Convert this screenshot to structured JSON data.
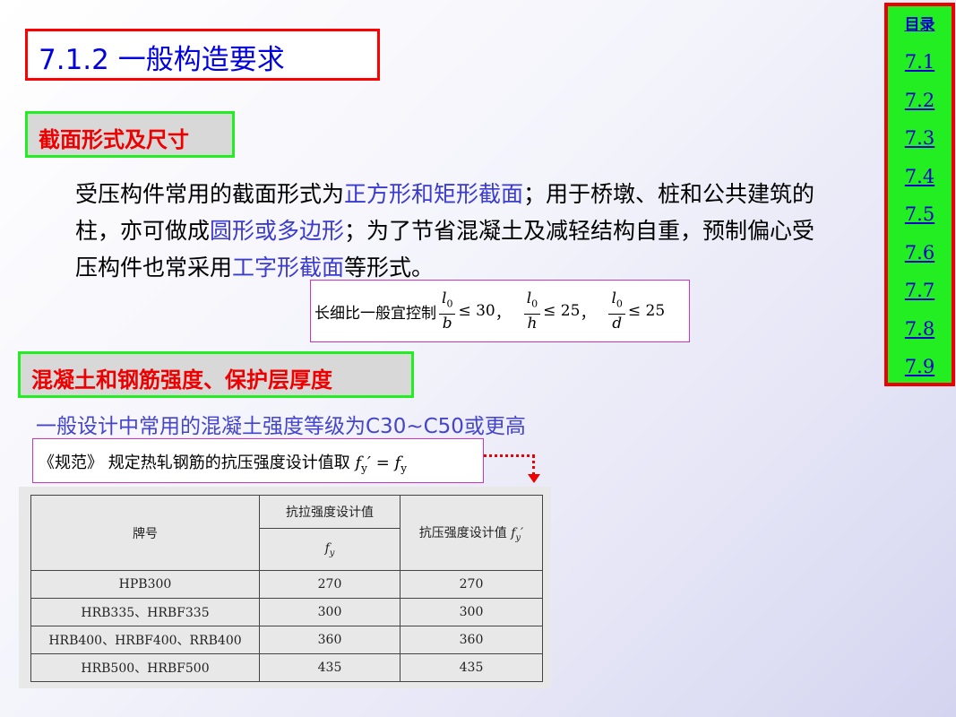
{
  "title": "7.1.2 一般构造要求",
  "section1": "截面形式及尺寸",
  "paragraph": [
    {
      "t": "受压构件常用的截面形式为",
      "hl": false
    },
    {
      "t": "正方形和矩形截面",
      "hl": true
    },
    {
      "t": "；用于桥墩、桩和公共建筑的柱，亦可做成",
      "hl": false
    },
    {
      "t": "圆形或多边形",
      "hl": true
    },
    {
      "t": "；为了节省混凝土及减轻结构自重，预制偏心受压构件也常采用",
      "hl": false
    },
    {
      "t": "工字形截面",
      "hl": true
    },
    {
      "t": "等形式。",
      "hl": false
    }
  ],
  "ratio": {
    "prefix": "长细比一般宜控制",
    "items": [
      {
        "num": "l",
        "sub": "0",
        "den": "b",
        "rest": "≤ 30",
        "sep": "，"
      },
      {
        "num": "l",
        "sub": "0",
        "den": "h",
        "rest": "≤ 25",
        "sep": "，"
      },
      {
        "num": "l",
        "sub": "0",
        "den": "d",
        "rest": "≤ 25",
        "sep": ""
      }
    ]
  },
  "section2": "混凝土和钢筋强度、保护层厚度",
  "concrete_line": "一般设计中常用的混凝土强度等级为C30~C50或更高",
  "spec_line": {
    "text": "《规范》 规定热轧钢筋的抗压强度设计值取",
    "formula_lhs": "f",
    "lhs_sub": "y",
    "lhs_prime": "′",
    "eq": " = ",
    "formula_rhs": "f",
    "rhs_sub": "y"
  },
  "table": {
    "col1_header": "牌号",
    "col2_header": "抗拉强度设计值",
    "col2_symbol": "f",
    "col2_sub": "y",
    "col3_header": "抗压强度设计值",
    "col3_symbol": "f",
    "col3_sub": "y",
    "col3_prime": "′",
    "rows": [
      [
        "HPB300",
        "270",
        "270"
      ],
      [
        "HRB335、HRBF335",
        "300",
        "300"
      ],
      [
        "HRB400、HRBF400、RRB400",
        "360",
        "360"
      ],
      [
        "HRB500、HRBF500",
        "435",
        "435"
      ]
    ]
  },
  "nav": {
    "toc": "目录",
    "items": [
      "7.1",
      "7.2",
      "7.3",
      "7.4",
      "7.5",
      "7.6",
      "7.7",
      "7.8",
      "7.9"
    ]
  },
  "colors": {
    "title_border": "#ff0000",
    "heading_border": "#22ee22",
    "heading_text": "#ee0000",
    "highlight": "#3b3bd0",
    "nav_bg": "#22ee22"
  }
}
